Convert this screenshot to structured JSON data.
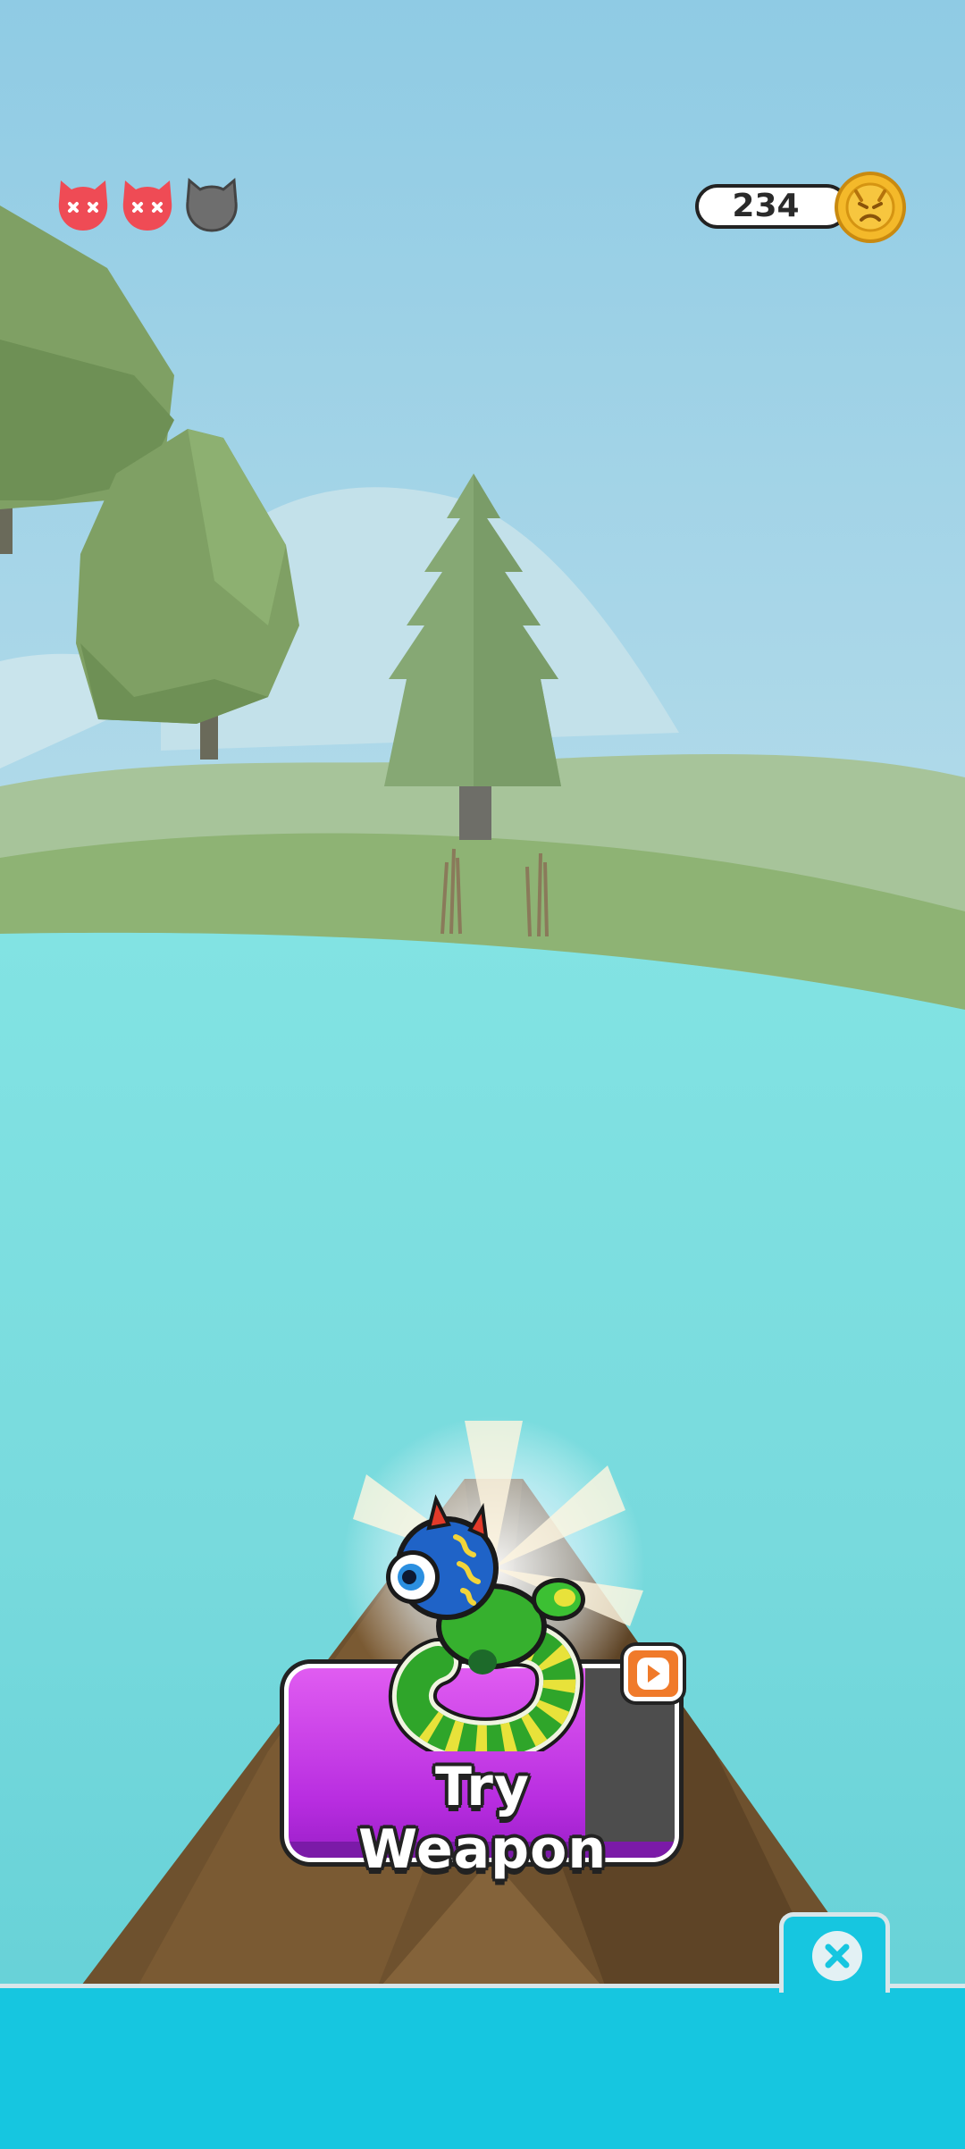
{
  "hud": {
    "lives": [
      {
        "state": "defeated",
        "color": "#ef4b55"
      },
      {
        "state": "defeated",
        "color": "#ef4b55"
      },
      {
        "state": "remaining",
        "color": "#6e6e6e"
      }
    ],
    "coins": "234",
    "coin_icon": "angry-face-coin-icon"
  },
  "weapon_offer": {
    "button_label": "Try Weapon",
    "ad_icon": "video-play-icon",
    "weapon_icon": "monster-weapon-icon"
  },
  "bottom_bar": {
    "close_icon": "close-icon"
  },
  "colors": {
    "sky": "#8ecbe3",
    "water": "#6fd7dc",
    "grass": "#93b77c",
    "boat": "#6e512e",
    "button_purple": "#c23de6",
    "bottom_panel": "#16c6e0"
  }
}
